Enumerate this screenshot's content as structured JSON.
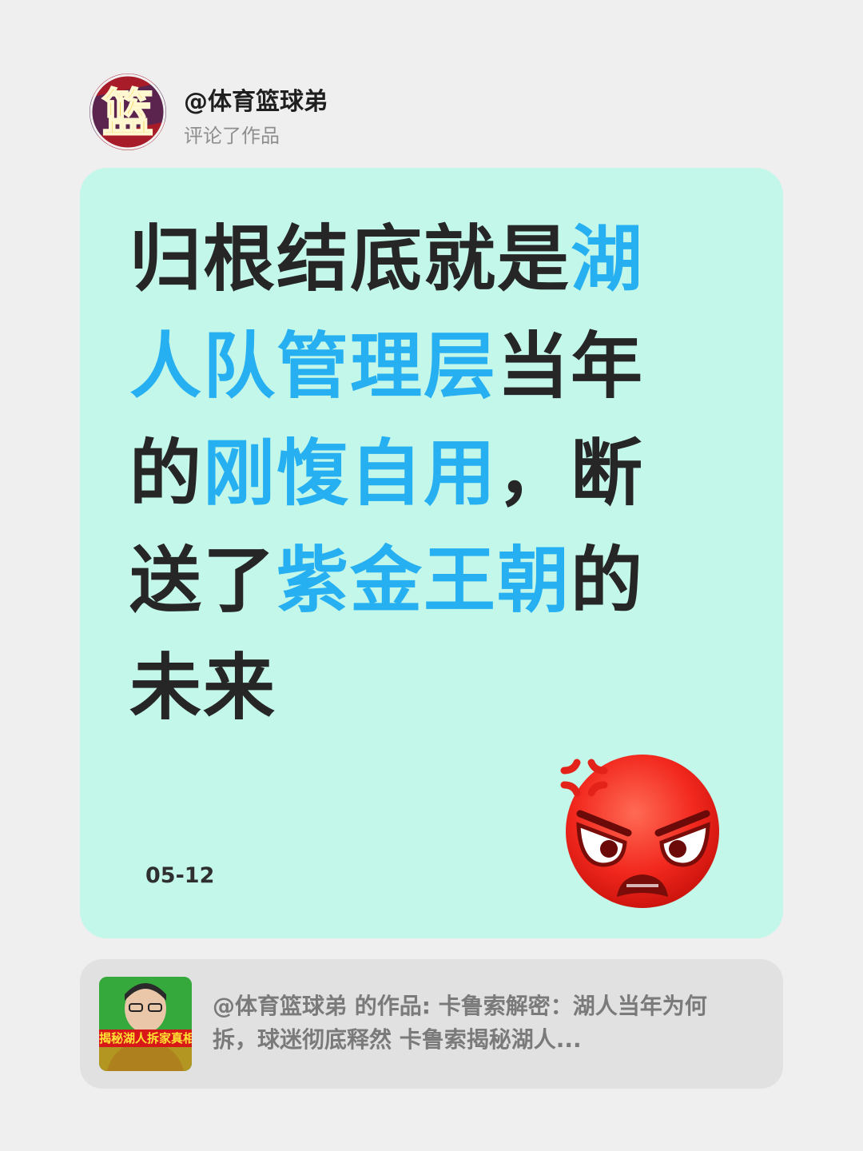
{
  "header": {
    "avatar_char": "篮",
    "username": "@体育篮球弟",
    "action": "评论了作品"
  },
  "comment": {
    "headline_segments": [
      {
        "text": "归根结底就是",
        "highlight": false
      },
      {
        "text": "湖人队管理层",
        "highlight": true
      },
      {
        "text": "当年的",
        "highlight": false
      },
      {
        "text": "刚愎自用",
        "highlight": true
      },
      {
        "text": "，断送了",
        "highlight": false
      },
      {
        "text": "紫金王朝",
        "highlight": true
      },
      {
        "text": "的未来",
        "highlight": false
      }
    ],
    "date": "05-12",
    "emoji": "angry-face-icon"
  },
  "reference": {
    "thumb_banner": "揭秘湖人拆家真相",
    "text": "@体育篮球弟 的作品: 卡鲁索解密：湖人当年为何拆，球迷彻底释然 卡鲁索揭秘湖人..."
  },
  "colors": {
    "background": "#efefef",
    "card": "#c3f7e9",
    "highlight": "#27b0f1",
    "text": "#262626",
    "ref_card": "#e1e1e1"
  }
}
